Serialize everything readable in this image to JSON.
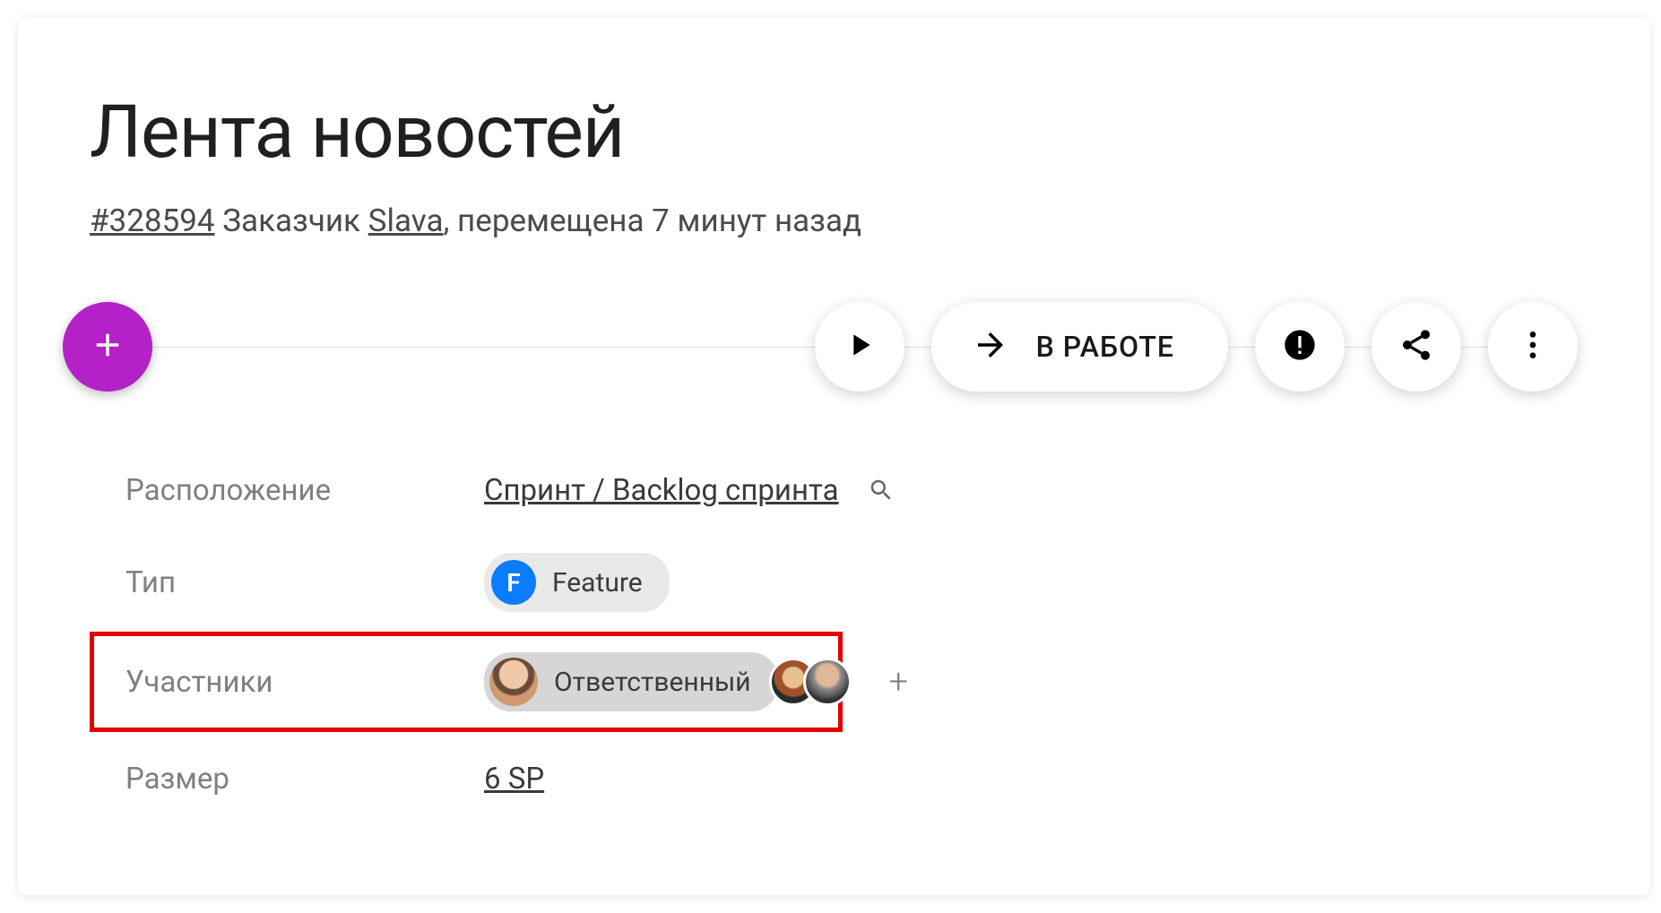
{
  "title": "Лента новостей",
  "subtitle": {
    "id": "#328594",
    "customer_label": "Заказчик",
    "customer_name": "Slava",
    "moved_text": ", перемещена 7 минут назад"
  },
  "actions": {
    "in_work_label": "В РАБОТЕ"
  },
  "details": {
    "location_label": "Расположение",
    "location_value": "Спринт / Backlog спринта",
    "type_label": "Тип",
    "type_badge_letter": "F",
    "type_value": "Feature",
    "members_label": "Участники",
    "responsible_label": "Ответственный",
    "size_label": "Размер",
    "size_value": "6 SP"
  }
}
